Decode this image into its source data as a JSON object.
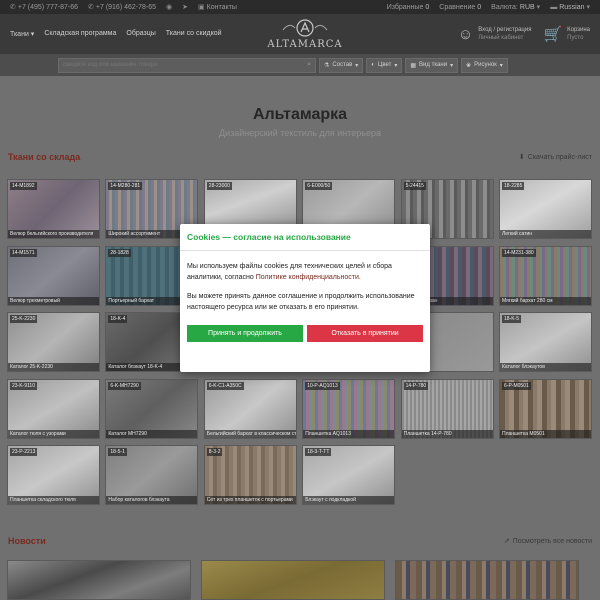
{
  "topbar": {
    "phone1": "+7 (495) 777-87-66",
    "phone2": "+7 (916) 462-78-65",
    "contacts": "Контакты",
    "favorites_label": "Избранные",
    "favorites_count": "0",
    "compare_label": "Сравнение",
    "compare_count": "0",
    "currency_label": "Валюта:",
    "currency_value": "RUB",
    "language": "Russian"
  },
  "header": {
    "nav": [
      "Ткани",
      "Складская программа",
      "Образцы",
      "Ткани со скидкой"
    ],
    "logo_text": "ALTAMARCA",
    "login_title": "Вход / регистрация",
    "login_sub": "Личный кабинет",
    "cart_title": "Корзина",
    "cart_sub": "Пусто"
  },
  "filters": {
    "search_placeholder": "Введите код или название товара",
    "buttons": [
      "Состав",
      "Цвет",
      "Вид ткани",
      "Рисунок"
    ]
  },
  "page": {
    "title": "Альтамарка",
    "subtitle": "Дизайнерский текстиль для интерьера"
  },
  "stock_section": {
    "title": "Ткани со склада",
    "link": "Скачать прайс-лист"
  },
  "tiles": [
    {
      "code": "14-M1892",
      "caption": "Велюр бельгийского производителя"
    },
    {
      "code": "14-M280-281",
      "caption": "Широкий ассортимент"
    },
    {
      "code": "28-23000",
      "caption": ""
    },
    {
      "code": "6-E000/50",
      "caption": ""
    },
    {
      "code": "5-24415",
      "caption": ""
    },
    {
      "code": "18-2285",
      "caption": "Легкий сатин"
    },
    {
      "code": "14-M1571",
      "caption": "Велюр трехметровый"
    },
    {
      "code": "28-1828",
      "caption": "Портьерный бархат"
    },
    {
      "code": "",
      "caption": ""
    },
    {
      "code": "",
      "caption": ""
    },
    {
      "code": "",
      "caption": "Бархат «лоза»"
    },
    {
      "code": "14-M231-380",
      "caption": "Мягкий бархат 280 см"
    },
    {
      "code": "25-K-2230",
      "caption": "Каталог 25-K-2230"
    },
    {
      "code": "18-K-4",
      "caption": "Каталог блэкаут 18-K-4"
    },
    {
      "code": "",
      "caption": ""
    },
    {
      "code": "",
      "caption": ""
    },
    {
      "code": "",
      "caption": ""
    },
    {
      "code": "18-K-5",
      "caption": "Каталог блэкаутов"
    },
    {
      "code": "23-K-9110",
      "caption": "Каталог тюля с узорами"
    },
    {
      "code": "6-K-MH7290",
      "caption": "Каталог MH7290"
    },
    {
      "code": "6-K-C1-A350C",
      "caption": "Бельгийский бархат в классическом стиле"
    },
    {
      "code": "10-P-AQ1013",
      "caption": "Планшетка AQ1013"
    },
    {
      "code": "14-P-780",
      "caption": "Планшетка 14-P-780"
    },
    {
      "code": "6-P-M0501",
      "caption": "Планшетка M0501"
    },
    {
      "code": "23-P-2213",
      "caption": "Планшетка складского тюля"
    },
    {
      "code": "18-5-1",
      "caption": "Набор каталогов блэкаута"
    },
    {
      "code": "8-3-2",
      "caption": "Сет из трех планшеток с портьерами"
    },
    {
      "code": "18-3-T-TT",
      "caption": "Блэкаут с подкладкой"
    }
  ],
  "news_section": {
    "title": "Новости",
    "link": "Посмотреть все новости"
  },
  "cookie_modal": {
    "title": "Cookies — согласие на использование",
    "text1": "Мы используем файлы cookies для технических целей и сбора аналитики, согласно ",
    "policy_link": "Политике конфиденциальности",
    "text1_end": ".",
    "text2": "Вы можете принять данное соглашение и продолжить использование настоящего ресурса или же отказать в его принятии.",
    "accept": "Принять и продолжить",
    "reject": "Отказать в принятии",
    "colors": {
      "title": "#28a745",
      "accept": "#28a745",
      "reject": "#dc3545",
      "link": "#7a2a1f"
    }
  }
}
